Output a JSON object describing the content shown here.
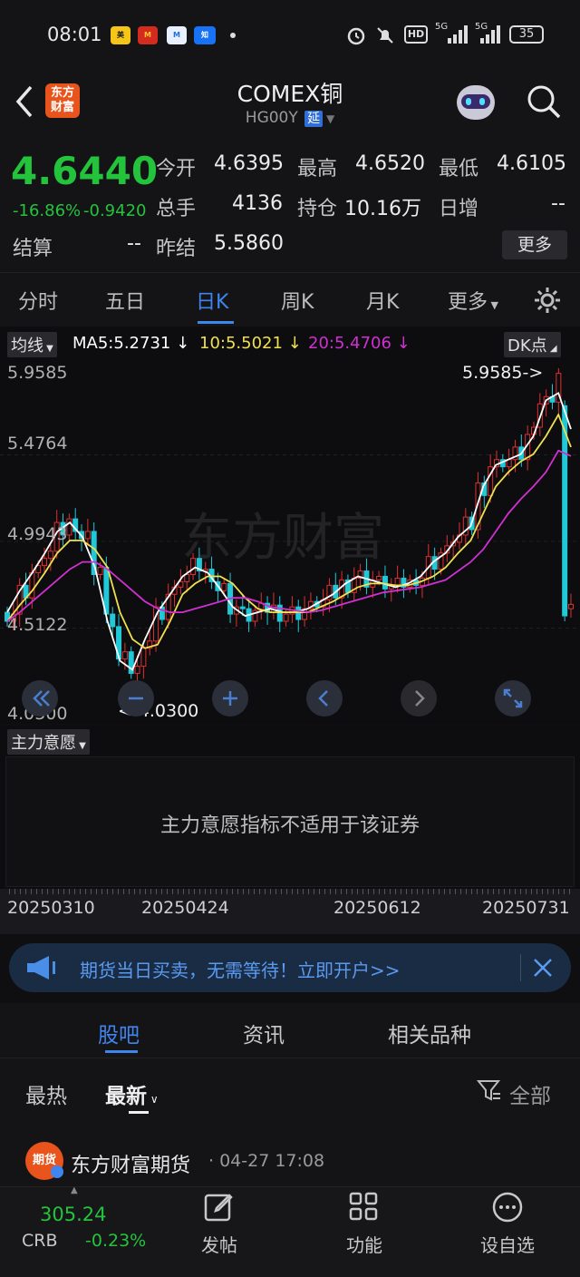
{
  "status": {
    "time": "08:01",
    "battery": "35",
    "net1": "5G",
    "net2": "5G",
    "hd": "HD"
  },
  "header": {
    "title": "COMEX铜",
    "code": "HG00Y",
    "code_badge": "延",
    "logo_text": "东方财富"
  },
  "quote": {
    "price": "4.6440",
    "change_pct": "-16.86%",
    "change": "-0.9420",
    "open_label": "今开",
    "open": "4.6395",
    "high_label": "最高",
    "high": "4.6520",
    "low_label": "最低",
    "low": "4.6105",
    "volume_label": "总手",
    "volume": "4136",
    "oi_label": "持仓",
    "oi": "10.16万",
    "daily_inc_label": "日增",
    "daily_inc": "--",
    "settle_label": "结算",
    "settle": "--",
    "prev_settle_label": "昨结",
    "prev_settle": "5.5860",
    "more_label": "更多"
  },
  "tabs": [
    "分时",
    "五日",
    "日K",
    "周K",
    "月K",
    "更多"
  ],
  "chart": {
    "ma_dropdown": "均线",
    "ma5": "MA5:5.2731",
    "ma10": "10:5.5021",
    "ma20": "20:5.4706",
    "dk": "DK点",
    "y_labels": [
      "5.9585",
      "5.4764",
      "4.9943",
      "4.5122",
      "4.0300"
    ],
    "max_marker": "5.9585->",
    "min_marker": "<-4.0300",
    "watermark": "东方财富",
    "colors": {
      "ma5": "#ffffff",
      "ma10": "#f0e050",
      "ma20": "#d030d0",
      "up": "#e03030",
      "down": "#20c8d8"
    }
  },
  "chart_data": {
    "type": "candlestick",
    "y_range": [
      4.03,
      5.9585
    ],
    "x_labels": [
      "20250310",
      "20250424",
      "20250612",
      "20250731"
    ],
    "max": 5.9585,
    "min": 4.03,
    "ma_series": [
      {
        "name": "MA5",
        "values": [
          4.6,
          4.72,
          4.82,
          4.93,
          5.05,
          5.1,
          5.02,
          4.85,
          4.55,
          4.33,
          4.28,
          4.45,
          4.6,
          4.7,
          4.8,
          4.85,
          4.82,
          4.73,
          4.63,
          4.58,
          4.6,
          4.62,
          4.6,
          4.6,
          4.62,
          4.66,
          4.7,
          4.76,
          4.8,
          4.78,
          4.76,
          4.74,
          4.76,
          4.8,
          4.88,
          4.93,
          5.02,
          5.08,
          5.3,
          5.42,
          5.45,
          5.48,
          5.58,
          5.78,
          5.82,
          5.62
        ]
      },
      {
        "name": "MA10",
        "values": [
          4.55,
          4.64,
          4.72,
          4.82,
          4.93,
          5.0,
          5.0,
          4.95,
          4.85,
          4.6,
          4.45,
          4.4,
          4.42,
          4.55,
          4.7,
          4.76,
          4.8,
          4.8,
          4.76,
          4.68,
          4.62,
          4.6,
          4.6,
          4.6,
          4.6,
          4.63,
          4.66,
          4.7,
          4.74,
          4.76,
          4.76,
          4.75,
          4.75,
          4.77,
          4.8,
          4.85,
          4.93,
          5.0,
          5.15,
          5.3,
          5.38,
          5.44,
          5.48,
          5.58,
          5.7,
          5.52
        ]
      },
      {
        "name": "MA20",
        "values": [
          4.55,
          4.6,
          4.66,
          4.72,
          4.78,
          4.84,
          4.88,
          4.88,
          4.84,
          4.78,
          4.72,
          4.66,
          4.62,
          4.6,
          4.6,
          4.62,
          4.64,
          4.66,
          4.68,
          4.68,
          4.66,
          4.63,
          4.62,
          4.61,
          4.6,
          4.61,
          4.63,
          4.65,
          4.67,
          4.69,
          4.71,
          4.72,
          4.73,
          4.74,
          4.76,
          4.78,
          4.83,
          4.88,
          4.95,
          5.05,
          5.15,
          5.23,
          5.3,
          5.38,
          5.5,
          5.47
        ]
      }
    ]
  },
  "indicator": {
    "dropdown": "主力意愿",
    "message": "主力意愿指标不适用于该证券"
  },
  "banner": {
    "text": "期货当日买卖，无需等待！立即开户>>"
  },
  "content_tabs": [
    "股吧",
    "资讯",
    "相关品种"
  ],
  "feed": {
    "sort_hot": "最热",
    "sort_new": "最新",
    "filter": "全部",
    "post_author": "东方财富期货",
    "post_time": "· 04-27 17:08",
    "avatar_text": "期货"
  },
  "bottom": {
    "index_value": "305.24",
    "index_name": "CRB",
    "index_change": "-0.23%",
    "post": "发帖",
    "func": "功能",
    "watch": "设自选"
  }
}
